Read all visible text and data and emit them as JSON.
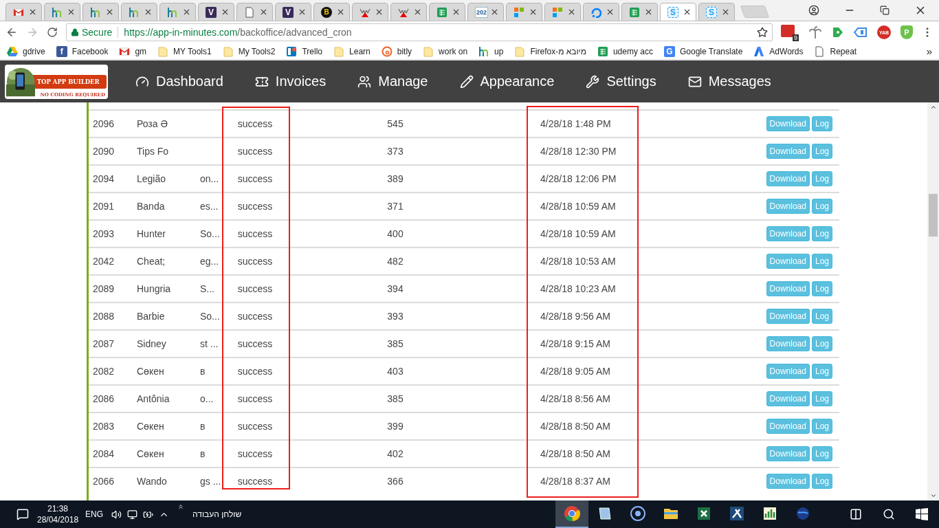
{
  "tabs": [
    {
      "kind": "gmail",
      "selected": false
    },
    {
      "kind": "hm",
      "selected": false
    },
    {
      "kind": "hm",
      "selected": false
    },
    {
      "kind": "hm",
      "selected": false
    },
    {
      "kind": "hm",
      "selected": false
    },
    {
      "kind": "v",
      "glyph": "V",
      "selected": false
    },
    {
      "kind": "doc",
      "selected": false
    },
    {
      "kind": "v",
      "glyph": "V",
      "selected": false
    },
    {
      "kind": "bhw",
      "glyph": "B",
      "selected": false
    },
    {
      "kind": "w",
      "selected": false
    },
    {
      "kind": "w",
      "selected": false
    },
    {
      "kind": "sheets",
      "selected": false
    },
    {
      "kind": "text",
      "glyph": "202",
      "selected": false
    },
    {
      "kind": "squares",
      "selected": false
    },
    {
      "kind": "squares",
      "selected": false
    },
    {
      "kind": "cloud",
      "selected": false
    },
    {
      "kind": "sheets",
      "selected": false
    },
    {
      "kind": "s",
      "glyph": "S",
      "selected": true
    },
    {
      "kind": "s",
      "glyph": "S",
      "selected": false
    }
  ],
  "address_bar": {
    "secure_label": "Secure",
    "url_host": "https://app-in-minutes.com",
    "url_path": "/backoffice/advanced_cron"
  },
  "extensions": [
    {
      "kind": "lastpass",
      "badge": "9"
    },
    {
      "kind": "palm"
    },
    {
      "kind": "green-tag"
    },
    {
      "kind": "blue-tag"
    },
    {
      "kind": "round",
      "glyph": "YAB"
    },
    {
      "kind": "shield",
      "glyph": "P"
    }
  ],
  "bookmarks": [
    {
      "kind": "drive",
      "label": "gdrive"
    },
    {
      "kind": "facebook",
      "glyph": "f",
      "label": "Facebook"
    },
    {
      "kind": "gmail",
      "label": "gm"
    },
    {
      "kind": "folder",
      "label": "MY Tools1"
    },
    {
      "kind": "folder",
      "label": "My Tools2"
    },
    {
      "kind": "trello",
      "label": "Trello"
    },
    {
      "kind": "folder",
      "label": "Learn"
    },
    {
      "kind": "bitly",
      "label": "bitly"
    },
    {
      "kind": "folder",
      "label": "work on"
    },
    {
      "kind": "hm",
      "label": "up"
    },
    {
      "kind": "folder",
      "label": "Firefox-מיובא מ"
    },
    {
      "kind": "sheets",
      "label": "udemy acc"
    },
    {
      "kind": "translate",
      "glyph": "G",
      "label": "Google Translate"
    },
    {
      "kind": "adwords",
      "label": "AdWords"
    },
    {
      "kind": "doc",
      "label": "Repeat"
    }
  ],
  "bookmarks_more": "»",
  "logo": {
    "title": "TOP APP BUILDER",
    "tagline": "NO CODING REQUIRED"
  },
  "nav": [
    {
      "kind": "gauge",
      "label": "Dashboard"
    },
    {
      "kind": "ticket",
      "label": "Invoices"
    },
    {
      "kind": "users",
      "label": "Manage"
    },
    {
      "kind": "pencil",
      "label": "Appearance"
    },
    {
      "kind": "wrench",
      "label": "Settings"
    },
    {
      "kind": "mail",
      "label": "Messages"
    }
  ],
  "rows": [
    {
      "id": "2096",
      "name_start": "Роза Ә",
      "name_end": "",
      "status": "success",
      "count": "545",
      "date": "4/28/18 1:48 PM",
      "actions": [
        "Download",
        "Log"
      ]
    },
    {
      "id": "2090",
      "name_start": "Tips Fo",
      "name_end": "",
      "status": "success",
      "count": "373",
      "date": "4/28/18 12:30 PM",
      "actions": [
        "Download",
        "Log"
      ]
    },
    {
      "id": "2094",
      "name_start": "Legião",
      "name_end": "on...",
      "status": "success",
      "count": "389",
      "date": "4/28/18 12:06 PM",
      "actions": [
        "Download",
        "Log"
      ]
    },
    {
      "id": "2091",
      "name_start": "Banda",
      "name_end": "es...",
      "status": "success",
      "count": "371",
      "date": "4/28/18 10:59 AM",
      "actions": [
        "Download",
        "Log"
      ]
    },
    {
      "id": "2093",
      "name_start": "Hunter",
      "name_end": "So...",
      "status": "success",
      "count": "400",
      "date": "4/28/18 10:59 AM",
      "actions": [
        "Download",
        "Log"
      ]
    },
    {
      "id": "2042",
      "name_start": "Cheat;",
      "name_end": "eg...",
      "status": "success",
      "count": "482",
      "date": "4/28/18 10:53 AM",
      "actions": [
        "Download",
        "Log"
      ]
    },
    {
      "id": "2089",
      "name_start": "Hungria",
      "name_end": "S...",
      "status": "success",
      "count": "394",
      "date": "4/28/18 10:23 AM",
      "actions": [
        "Download",
        "Log"
      ]
    },
    {
      "id": "2088",
      "name_start": "Barbie",
      "name_end": "So...",
      "status": "success",
      "count": "393",
      "date": "4/28/18 9:56 AM",
      "actions": [
        "Download",
        "Log"
      ]
    },
    {
      "id": "2087",
      "name_start": "Sidney",
      "name_end": "st ...",
      "status": "success",
      "count": "385",
      "date": "4/28/18 9:15 AM",
      "actions": [
        "Download",
        "Log"
      ]
    },
    {
      "id": "2082",
      "name_start": "Сөкен",
      "name_end": "в",
      "status": "success",
      "count": "403",
      "date": "4/28/18 9:05 AM",
      "actions": [
        "Download",
        "Log"
      ]
    },
    {
      "id": "2086",
      "name_start": "Antônia",
      "name_end": "o...",
      "status": "success",
      "count": "385",
      "date": "4/28/18 8:56 AM",
      "actions": [
        "Download",
        "Log"
      ]
    },
    {
      "id": "2083",
      "name_start": "Сөкен",
      "name_end": "в",
      "status": "success",
      "count": "399",
      "date": "4/28/18 8:50 AM",
      "actions": [
        "Download",
        "Log"
      ]
    },
    {
      "id": "2084",
      "name_start": "Сөкен",
      "name_end": "в",
      "status": "success",
      "count": "402",
      "date": "4/28/18 8:50 AM",
      "actions": [
        "Download",
        "Log"
      ]
    },
    {
      "id": "2066",
      "name_start": "Wando",
      "name_end": "gs ...",
      "status": "success",
      "count": "366",
      "date": "4/28/18 8:37 AM",
      "actions": [
        "Download",
        "Log"
      ]
    }
  ],
  "taskbar": {
    "time": "21:38",
    "date": "28/04/2018",
    "language": "ENG",
    "toolbar_label": "שולחן העבודה",
    "apps": [
      {
        "kind": "chrome",
        "selected": true
      },
      {
        "kind": "notebook",
        "selected": false
      },
      {
        "kind": "cortana",
        "selected": false
      },
      {
        "kind": "explorer",
        "selected": false
      },
      {
        "kind": "excel",
        "selected": false
      },
      {
        "kind": "tool",
        "selected": false
      },
      {
        "kind": "chart",
        "selected": false
      },
      {
        "kind": "globe",
        "selected": false
      }
    ]
  }
}
